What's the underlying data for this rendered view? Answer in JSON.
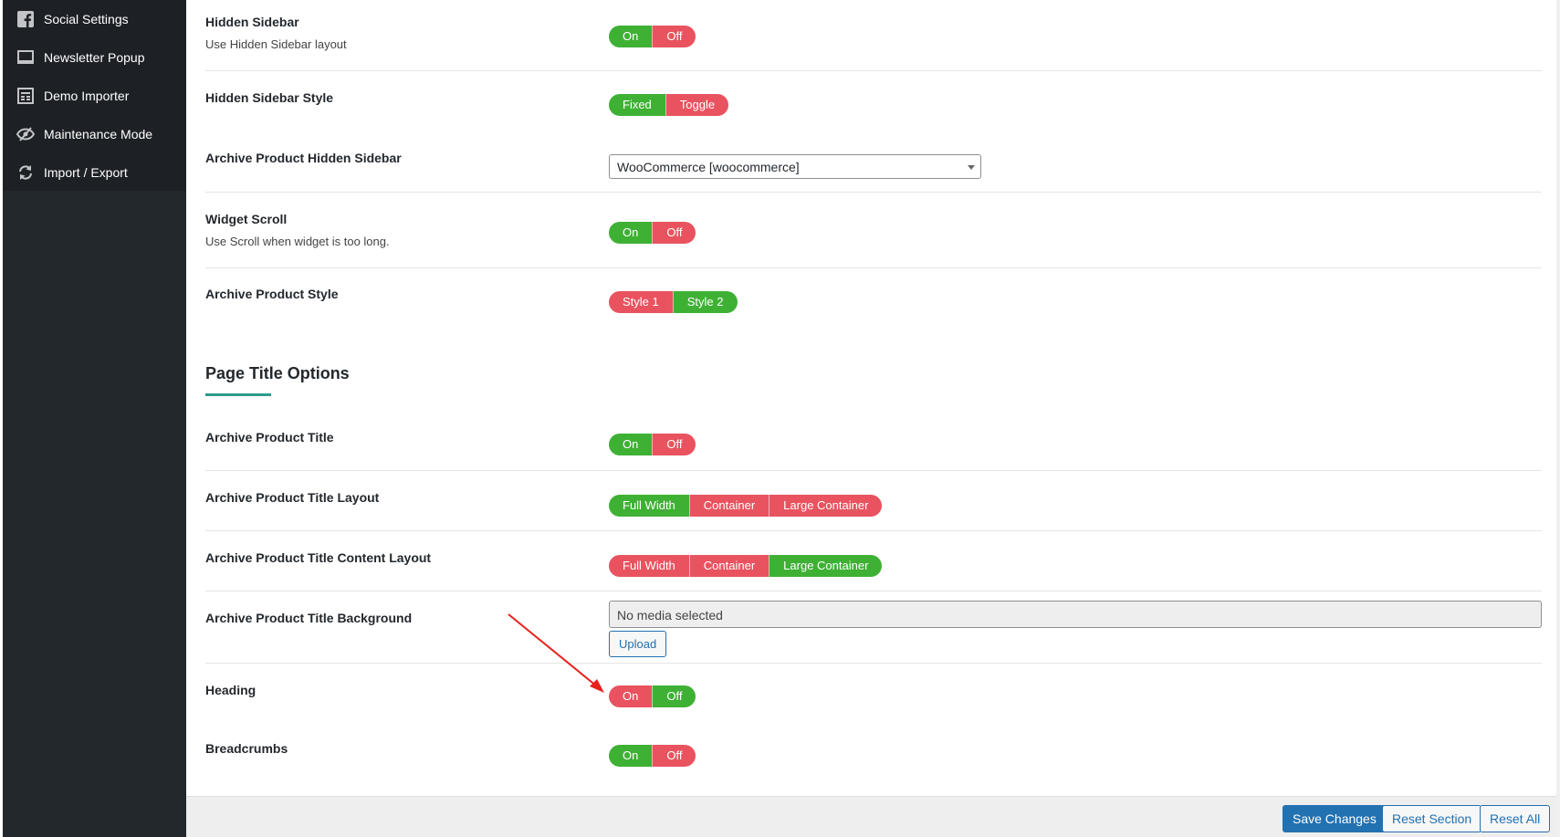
{
  "sidebar": {
    "items": [
      {
        "label": "Social Settings",
        "icon": "facebook-icon"
      },
      {
        "label": "Newsletter Popup",
        "icon": "monitor-icon"
      },
      {
        "label": "Demo Importer",
        "icon": "import-icon"
      },
      {
        "label": "Maintenance Mode",
        "icon": "eye-slash-icon"
      },
      {
        "label": "Import / Export",
        "icon": "refresh-icon"
      }
    ]
  },
  "settings": {
    "hidden_sidebar": {
      "title": "Hidden Sidebar",
      "desc": "Use Hidden Sidebar layout",
      "options": [
        "On",
        "Off"
      ],
      "selected": "On"
    },
    "hidden_sidebar_style": {
      "title": "Hidden Sidebar Style",
      "options": [
        "Fixed",
        "Toggle"
      ],
      "selected": "Fixed"
    },
    "archive_hidden_sidebar": {
      "title": "Archive Product Hidden Sidebar",
      "value": "WooCommerce [woocommerce]"
    },
    "widget_scroll": {
      "title": "Widget Scroll",
      "desc": "Use Scroll when widget is too long.",
      "options": [
        "On",
        "Off"
      ],
      "selected": "On"
    },
    "archive_product_style": {
      "title": "Archive Product Style",
      "options": [
        "Style 1",
        "Style 2"
      ],
      "selected": "Style 2"
    }
  },
  "page_title_section": {
    "heading": "Page Title Options",
    "archive_product_title": {
      "title": "Archive Product Title",
      "options": [
        "On",
        "Off"
      ],
      "selected": "On"
    },
    "title_layout": {
      "title": "Archive Product Title Layout",
      "options": [
        "Full Width",
        "Container",
        "Large Container"
      ],
      "selected": "Full Width"
    },
    "title_content_layout": {
      "title": "Archive Product Title Content Layout",
      "options": [
        "Full Width",
        "Container",
        "Large Container"
      ],
      "selected": "Large Container"
    },
    "title_background": {
      "title": "Archive Product Title Background",
      "media_value": "No media selected",
      "upload_label": "Upload"
    },
    "heading_toggle": {
      "title": "Heading",
      "options": [
        "On",
        "Off"
      ],
      "selected": "Off"
    },
    "breadcrumbs": {
      "title": "Breadcrumbs",
      "options": [
        "On",
        "Off"
      ],
      "selected": "On"
    }
  },
  "footer": {
    "save_label": "Save Changes",
    "reset_section_label": "Reset Section",
    "reset_all_label": "Reset All"
  },
  "colors": {
    "active": "#3eb134",
    "inactive": "#e8535f",
    "primary": "#2271b1",
    "sidebar_bg": "#23282d",
    "annotation_arrow": "#e8211d"
  }
}
